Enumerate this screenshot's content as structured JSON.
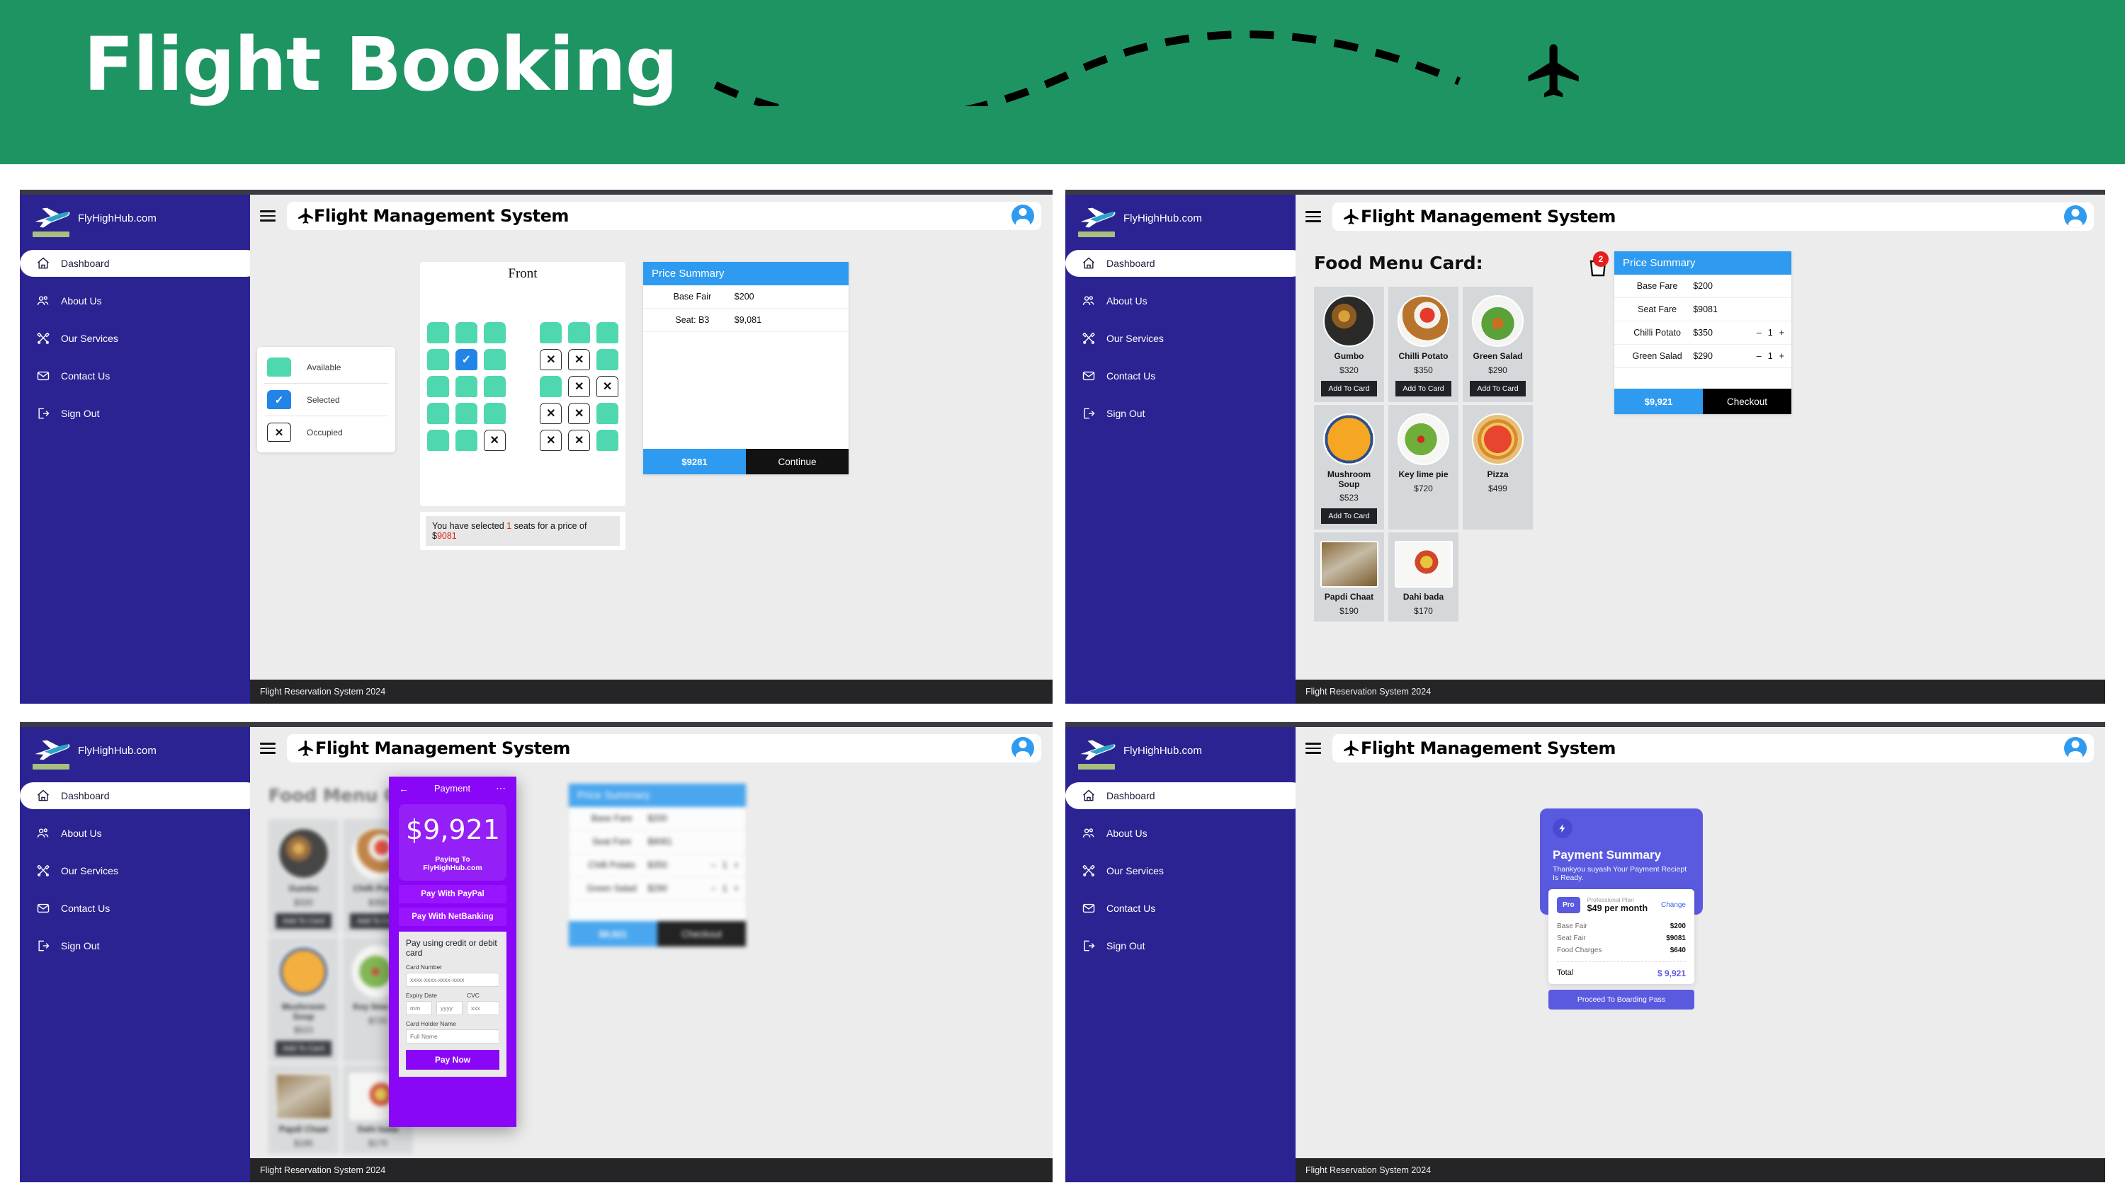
{
  "hero": {
    "title": "Flight Booking",
    "bg_color": "#1e9463",
    "plane_icon": "airplane-icon",
    "path_icon": "dashed-flight-path"
  },
  "brand": {
    "name": "FlyHighHub.com",
    "logo_icon": "airplane-logo"
  },
  "sidebar": {
    "items": [
      {
        "label": "Dashboard",
        "icon": "home-icon",
        "active": true
      },
      {
        "label": "About Us",
        "icon": "users-icon",
        "active": false
      },
      {
        "label": "Our Services",
        "icon": "tools-icon",
        "active": false
      },
      {
        "label": "Contact Us",
        "icon": "envelope-icon",
        "active": false
      },
      {
        "label": "Sign Out",
        "icon": "logout-icon",
        "active": false
      }
    ]
  },
  "topbar": {
    "title": "Flight Management System",
    "title_plane_icon": "airplane-icon",
    "menu_icon": "hamburger-icon",
    "avatar_icon": "user-avatar-icon"
  },
  "footer": {
    "text": "Flight Reservation System 2024"
  },
  "colors": {
    "accent_blue": "#2e9bf0",
    "sidebar_navy": "#2b2391",
    "seat_available": "#4fd8b0",
    "seat_selected": "#2384e8",
    "hero_green": "#1e9463",
    "purple": "#8a06f7",
    "indigo": "#5a5ae0",
    "danger_red": "#e2231a"
  },
  "panel1": {
    "front_label": "Front",
    "legend": [
      {
        "state": "available",
        "label": "Available",
        "glyph": ""
      },
      {
        "state": "selected",
        "label": "Selected",
        "glyph": "✓"
      },
      {
        "state": "occupied",
        "label": "Occupied",
        "glyph": "✕"
      }
    ],
    "seat_rows": [
      [
        "available",
        "available",
        "available",
        "aisle",
        "available",
        "available",
        "available"
      ],
      [
        "available",
        "selected",
        "available",
        "aisle",
        "occupied",
        "occupied",
        "available"
      ],
      [
        "available",
        "available",
        "available",
        "aisle",
        "available",
        "occupied",
        "occupied"
      ],
      [
        "available",
        "available",
        "available",
        "aisle",
        "occupied",
        "occupied",
        "available"
      ],
      [
        "available",
        "available",
        "occupied",
        "aisle",
        "occupied",
        "occupied",
        "available"
      ]
    ],
    "selection_note": {
      "prefix": "You have selected ",
      "count": "1",
      "middle": " seats for a price of $",
      "price": "9081"
    },
    "price_summary": {
      "heading": "Price Summary",
      "rows": [
        {
          "label": "Base Fair",
          "value": "$200"
        },
        {
          "label": "Seat: B3",
          "value": "$9,081"
        }
      ],
      "total": "$9281",
      "action": "Continue"
    }
  },
  "panel2": {
    "heading": "Food Menu Card:",
    "cart_icon": "shopping-bag-icon",
    "cart_count": "2",
    "add_button_label": "Add To Card",
    "food_items": [
      {
        "name": "Gumbo",
        "price": "$320",
        "has_button": true,
        "img": "gumbo-photo"
      },
      {
        "name": "Chilli Potato",
        "price": "$350",
        "has_button": true,
        "img": "chilli-potato-photo"
      },
      {
        "name": "Green Salad",
        "price": "$290",
        "has_button": true,
        "img": "green-salad-photo"
      },
      {
        "name": "Mushroom Soup",
        "price": "$523",
        "has_button": true,
        "img": "mushroom-soup-photo"
      },
      {
        "name": "Key lime pie",
        "price": "$720",
        "has_button": false,
        "img": "key-lime-pie-photo"
      },
      {
        "name": "Pizza",
        "price": "$499",
        "has_button": false,
        "img": "pizza-photo"
      },
      {
        "name": "Papdi Chaat",
        "price": "$190",
        "has_button": false,
        "img": "papdi-chaat-photo"
      },
      {
        "name": "Dahi bada",
        "price": "$170",
        "has_button": false,
        "img": "dahi-bada-photo"
      }
    ],
    "price_summary": {
      "heading": "Price Summary",
      "rows": [
        {
          "label": "Base Fare",
          "value": "$200",
          "qty": null
        },
        {
          "label": "Seat Fare",
          "value": "$9081",
          "qty": null
        },
        {
          "label": "Chilli Potato",
          "value": "$350",
          "qty": "1"
        },
        {
          "label": "Green Salad",
          "value": "$290",
          "qty": "1"
        }
      ],
      "minus": "–",
      "plus": "+",
      "total": "$9,921",
      "action": "Checkout"
    }
  },
  "panel3": {
    "heading": "Food Menu Card:",
    "payment": {
      "title": "Payment",
      "back_icon": "arrow-left-icon",
      "more_icon": "more-dots-icon",
      "amount": "$9,921",
      "paying_to": "Paying To FlyHighHub.com",
      "paypal_label": "Pay With PayPal",
      "netbanking_label": "Pay With NetBanking",
      "card_section_title": "Pay using credit or debit card",
      "fields": [
        {
          "label": "Card Number",
          "placeholder": "xxxx-xxxx-xxxx-xxxx"
        },
        {
          "label": "Expiry Date",
          "placeholder": "mm"
        },
        {
          "label": "",
          "placeholder": "yyyy"
        },
        {
          "label": "CVC",
          "placeholder": "xxx"
        },
        {
          "label": "Card Holder Name",
          "placeholder": "Full Name"
        }
      ],
      "submit_label": "Pay Now"
    }
  },
  "panel4": {
    "receipt": {
      "bolt_icon": "lightning-bolt-icon",
      "title": "Payment Summary",
      "subtitle": "Thankyou suyash Your Payment Reciept Is Ready.",
      "plan_chip": "Pro",
      "plan_name": "Professional Plan",
      "plan_price": "$49 per month",
      "change_label": "Change",
      "lines": [
        {
          "label": "Base Fair",
          "value": "$200"
        },
        {
          "label": "Seat Fair",
          "value": "$9081"
        },
        {
          "label": "Food Charges",
          "value": "$640"
        }
      ],
      "total_label": "Total",
      "total_value": "$ 9,921",
      "cta": "Proceed To Boarding Pass"
    }
  }
}
